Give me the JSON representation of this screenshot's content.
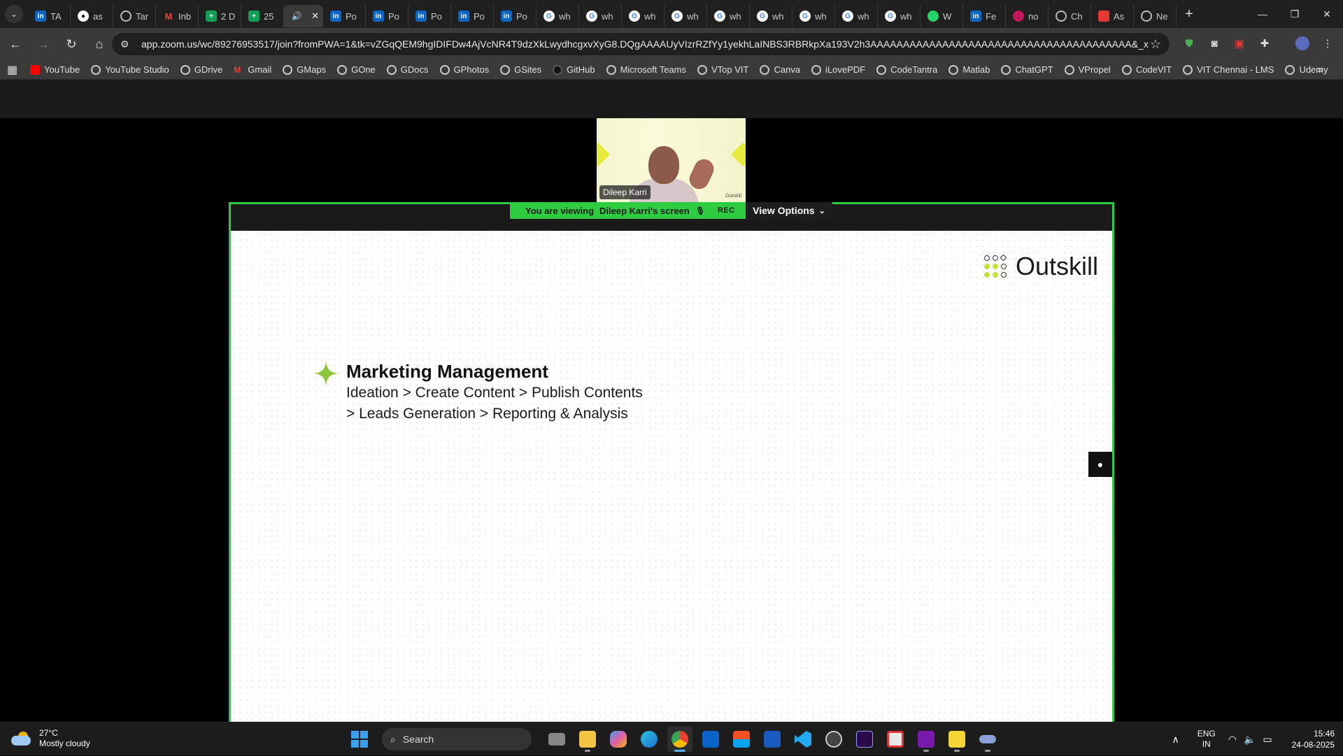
{
  "browser": {
    "tabs": [
      {
        "label": "TA",
        "icon": "linkedin-icon"
      },
      {
        "label": "as",
        "icon": "github-icon"
      },
      {
        "label": "Tar",
        "icon": "globe-icon"
      },
      {
        "label": "Inb",
        "icon": "gmail-icon"
      },
      {
        "label": "2 D",
        "icon": "sheets-icon"
      },
      {
        "label": "25",
        "icon": "sheets-icon"
      },
      {
        "label": "",
        "icon": "speaker-icon",
        "active": true
      },
      {
        "label": "Po",
        "icon": "linkedin-icon"
      },
      {
        "label": "Po",
        "icon": "linkedin-icon"
      },
      {
        "label": "Po",
        "icon": "linkedin-icon"
      },
      {
        "label": "Po",
        "icon": "linkedin-icon"
      },
      {
        "label": "Po",
        "icon": "linkedin-icon"
      },
      {
        "label": "wh",
        "icon": "google-icon"
      },
      {
        "label": "wh",
        "icon": "google-icon"
      },
      {
        "label": "wh",
        "icon": "google-icon"
      },
      {
        "label": "wh",
        "icon": "google-icon"
      },
      {
        "label": "wh",
        "icon": "google-icon"
      },
      {
        "label": "wh",
        "icon": "google-icon"
      },
      {
        "label": "wh",
        "icon": "google-icon"
      },
      {
        "label": "wh",
        "icon": "google-icon"
      },
      {
        "label": "wh",
        "icon": "google-icon"
      },
      {
        "label": "W",
        "icon": "whatsapp-icon"
      },
      {
        "label": "Fe",
        "icon": "linkedin-icon"
      },
      {
        "label": "no",
        "icon": "pink-icon"
      },
      {
        "label": "Ch",
        "icon": "chatgpt-icon"
      },
      {
        "label": "As",
        "icon": "youtube-icon"
      },
      {
        "label": "Ne",
        "icon": "chrome-icon"
      }
    ],
    "url": "app.zoom.us/wc/89276953517/join?fromPWA=1&tk=vZGqQEM9hgIDIFDw4AjVcNR4T9dzXkLwydhcgxvXyG8.DQgAAAAUyVIzrRZfYy1yekhLaINBS3RBRkpXa193V2h3AAAAAAAAAAAAAAAAAAAAAAAAAAAAAAAAAAAAAAAA&_x_zm_r...",
    "bookmarks": [
      "YouTube",
      "YouTube Studio",
      "GDrive",
      "Gmail",
      "GMaps",
      "GOne",
      "GDocs",
      "GPhotos",
      "GSites",
      "GitHub",
      "Microsoft Teams",
      "VTop VIT",
      "Canva",
      "iLovePDF",
      "CodeTantra",
      "Matlab",
      "ChatGPT",
      "VPropel",
      "CodeVIT",
      "VIT Chennai - LMS",
      "Udemy"
    ]
  },
  "zoom": {
    "participant_name": "Dileep Karri",
    "video_logo": "Outskill",
    "viewing_prefix": "You are viewing",
    "viewing_who": "Dileep Karri's screen",
    "rec_label": "REC",
    "view_options_label": "View Options",
    "accent_color": "#2ecc40"
  },
  "slide": {
    "brand": "Outskill",
    "title": "Marketing Management",
    "line1": "Ideation > Create Content > Publish Contents",
    "line2": "> Leads Generation > Reporting & Analysis",
    "accent_color": "#c8df3a"
  },
  "taskbar": {
    "temperature": "27°C",
    "weather": "Mostly cloudy",
    "search_placeholder": "Search",
    "lang_top": "ENG",
    "lang_bottom": "IN",
    "time": "15:46",
    "date": "24-08-2025"
  }
}
